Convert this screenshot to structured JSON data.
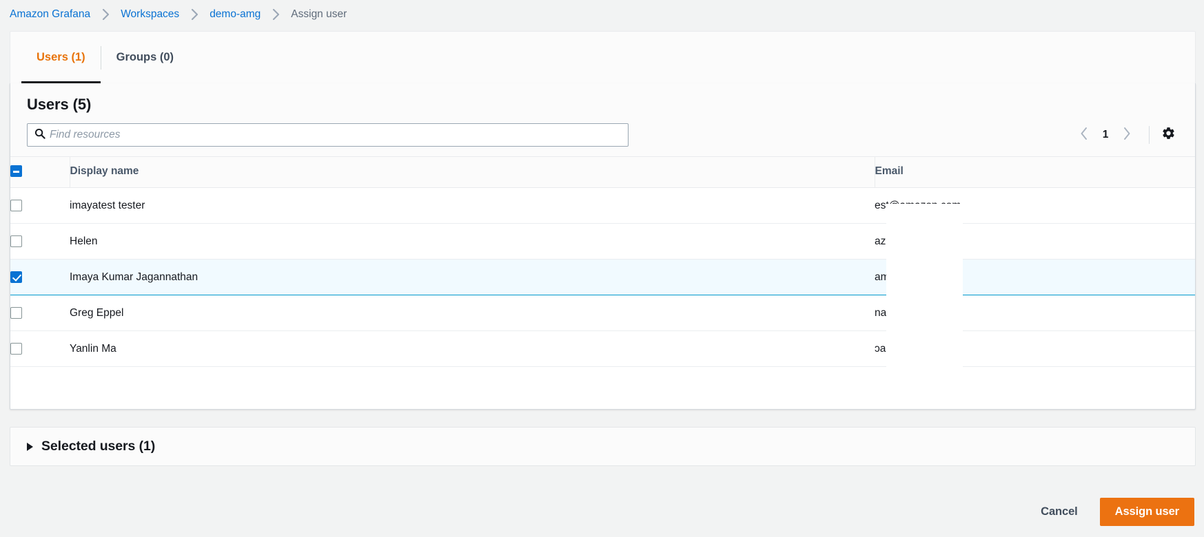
{
  "breadcrumb": {
    "items": [
      {
        "label": "Amazon Grafana",
        "current": false
      },
      {
        "label": "Workspaces",
        "current": false
      },
      {
        "label": "demo-amg",
        "current": false
      },
      {
        "label": "Assign user",
        "current": true
      }
    ]
  },
  "tabs": [
    {
      "label": "Users (1)",
      "active": true
    },
    {
      "label": "Groups (0)",
      "active": false
    }
  ],
  "panel": {
    "title": "Users (5)",
    "search": {
      "placeholder": "Find resources",
      "value": "",
      "icon": "search-icon"
    },
    "pagination": {
      "previous_icon": "chevron-left-icon",
      "next_icon": "chevron-right-icon",
      "current_page": "1"
    },
    "preferences": {
      "icon": "gear-icon"
    }
  },
  "table": {
    "select_all_state": "indeterminate",
    "columns": [
      {
        "key": "display_name",
        "label": "Display name"
      },
      {
        "key": "email",
        "label": "Email"
      }
    ],
    "rows": [
      {
        "display_name": "imayatest tester",
        "email": "est@amazon.com",
        "selected": false
      },
      {
        "display_name": "Helen",
        "email": "azon.com",
        "selected": false
      },
      {
        "display_name": "Imaya Kumar Jagannathan",
        "email": "amazon.com",
        "selected": true
      },
      {
        "display_name": "Greg Eppel",
        "email": "nazon.com",
        "selected": false
      },
      {
        "display_name": "Yanlin Ma",
        "email": "ɔamazon.com",
        "selected": false
      }
    ]
  },
  "selected_section": {
    "label": "Selected users (1)",
    "expanded": false,
    "caret_icon": "caret-right-icon"
  },
  "footer": {
    "cancel_label": "Cancel",
    "primary_label": "Assign user"
  },
  "colors": {
    "link": "#0972d3",
    "tab_active": "#e8730a",
    "primary_button": "#ec7211",
    "selected_row_border": "#0099cc",
    "selected_row_bg": "#f1faff",
    "checkbox_checked": "#0972d3"
  }
}
